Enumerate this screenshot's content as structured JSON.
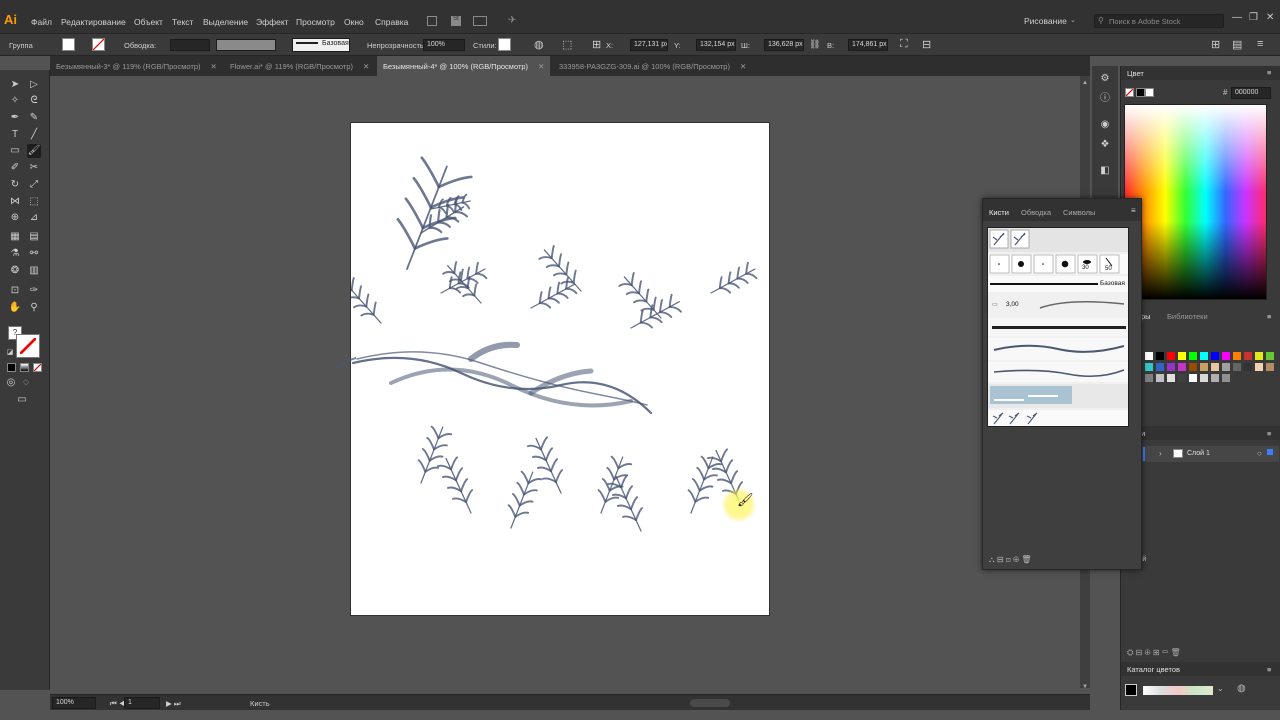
{
  "app": {
    "logo": "Ai"
  },
  "menu": [
    "Файл",
    "Редактирование",
    "Объект",
    "Текст",
    "Выделение",
    "Эффект",
    "Просмотр",
    "Окно",
    "Справка"
  ],
  "workspace": "Рисование",
  "search_placeholder": "Поиск в Adobe Stock",
  "control": {
    "selection_label": "Группа",
    "stroke_label": "Обводка:",
    "brush_name": "Базовая",
    "opacity_label": "Непрозрачность:",
    "opacity_value": "100%",
    "styles_label": "Стили:",
    "x_label": "X:",
    "x_value": "127,131 px",
    "y_label": "Y:",
    "y_value": "132,154 px",
    "w_label": "Ш:",
    "w_value": "136,628 px",
    "h_label": "В:",
    "h_value": "174,861 px"
  },
  "tabs": [
    {
      "label": "Безымянный-3* @ 119% (RGB/Просмотр)",
      "close": "✕"
    },
    {
      "label": "Flower.ai* @ 119% (RGB/Просмотр)",
      "close": "✕"
    },
    {
      "label": "Безымянный-4* @ 100% (RGB/Просмотр)",
      "close": "✕"
    },
    {
      "label": "333958-PA3GZG-309.ai @ 100% (RGB/Просмотр)",
      "close": "✕"
    }
  ],
  "status": {
    "zoom": "100%",
    "page": "1",
    "tool": "Кисть"
  },
  "color_panel": {
    "title": "Цвет",
    "hex": "000000"
  },
  "brushes_panel": {
    "tabs": [
      "Кисти",
      "Обводка",
      "Символы"
    ],
    "sizes": [
      "30",
      "50"
    ],
    "basic_label": "Базовая",
    "size_value": "3,00"
  },
  "swatches_panel": {
    "partial_tab_1": "ры",
    "partial_tab_2": "Библиотеки"
  },
  "layers_panel": {
    "title": "Слои",
    "layer_name": "Слой 1",
    "count": "1 слой"
  },
  "catalog": {
    "title": "Каталог цветов"
  },
  "colors": {
    "ink": "#4a5775",
    "accent": "#ff9a00",
    "swatches": [
      "#ffffff",
      "#000000",
      "#ff0000",
      "#ffff00",
      "#00ff00",
      "#00ffff",
      "#0000ff",
      "#ff00ff",
      "#ff7f00",
      "#c83232",
      "#e6e619",
      "#64c832",
      "#32c8c8",
      "#3264c8",
      "#9632c8",
      "#c832c8",
      "#964b00",
      "#c8a064",
      "#e6c8a0",
      "#a0a0a0",
      "#646464",
      "#323232",
      "#f0d2b4",
      "#b48c64"
    ]
  }
}
